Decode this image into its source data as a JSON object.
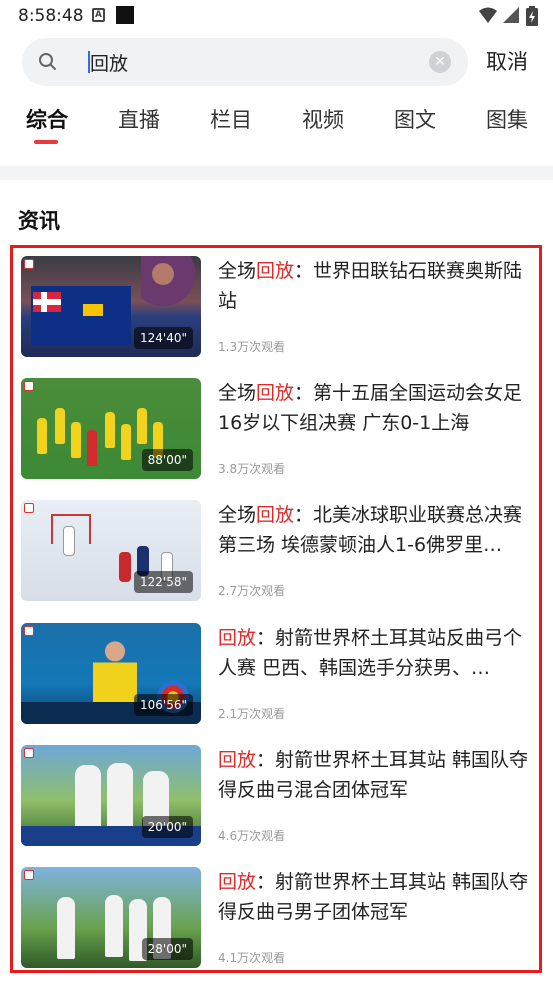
{
  "status": {
    "time": "8:58:48",
    "a_icon": "A"
  },
  "search": {
    "query": "回放",
    "placeholder": "",
    "cancel_label": "取消",
    "clear_glyph": "✕"
  },
  "tabs": [
    {
      "label": "综合",
      "active": true
    },
    {
      "label": "直播"
    },
    {
      "label": "栏目"
    },
    {
      "label": "视频"
    },
    {
      "label": "图文"
    },
    {
      "label": "图集"
    }
  ],
  "section_title": "资讯",
  "highlight_color": "#e51d1d",
  "accent_color": "#e02b2b",
  "items": [
    {
      "prefix": "全场",
      "keyword": "回放",
      "title_rest": "：世界田联钻石联赛奥斯陆站",
      "duration": "124'40\"",
      "views": "1.3万次观看"
    },
    {
      "prefix": "全场",
      "keyword": "回放",
      "title_rest": "：第十五届全国运动会女足16岁以下组决赛 广东0-1上海",
      "duration": "88'00\"",
      "views": "3.8万次观看"
    },
    {
      "prefix": "全场",
      "keyword": "回放",
      "title_rest": "：北美冰球职业联赛总决赛第三场 埃德蒙顿油人1-6佛罗里…",
      "duration": "122'58\"",
      "views": "2.7万次观看"
    },
    {
      "prefix": "",
      "keyword": "回放",
      "title_rest": "：射箭世界杯土耳其站反曲弓个人赛 巴西、韩国选手分获男、…",
      "duration": "106'56\"",
      "views": "2.1万次观看"
    },
    {
      "prefix": "",
      "keyword": "回放",
      "title_rest": "：射箭世界杯土耳其站 韩国队夺得反曲弓混合团体冠军",
      "duration": "20'00\"",
      "views": "4.6万次观看"
    },
    {
      "prefix": "",
      "keyword": "回放",
      "title_rest": "：射箭世界杯土耳其站 韩国队夺得反曲弓男子团体冠军",
      "duration": "28'00\"",
      "views": "4.1万次观看"
    }
  ]
}
